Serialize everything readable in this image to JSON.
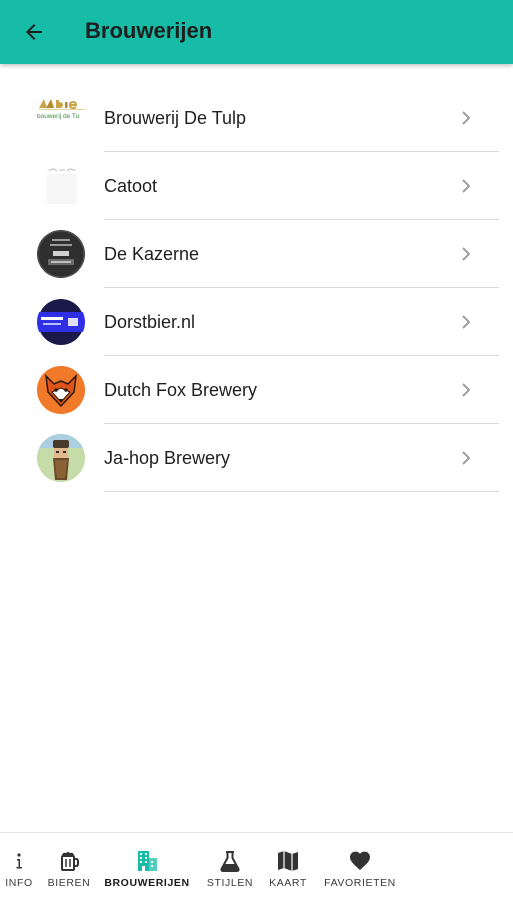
{
  "appbar": {
    "title": "Brouwerijen",
    "back_icon": "arrow-left-icon",
    "color": "#17bca7"
  },
  "breweries": [
    {
      "name": "Brouwerij De Tulp",
      "logo_text": "bouwerij de Tu"
    },
    {
      "name": "Catoot"
    },
    {
      "name": "De Kazerne"
    },
    {
      "name": "Dorstbier.nl"
    },
    {
      "name": "Dutch Fox Brewery"
    },
    {
      "name": "Ja-hop Brewery"
    }
  ],
  "bottom_nav": {
    "active": "brouwerijen",
    "accent": "#17bca7",
    "items": [
      {
        "label": "INFO",
        "icon": "info-icon"
      },
      {
        "label": "BIEREN",
        "icon": "beer-mug-icon"
      },
      {
        "label": "BROUWERIJEN",
        "icon": "building-icon"
      },
      {
        "label": "STIJLEN",
        "icon": "flask-icon"
      },
      {
        "label": "KAART",
        "icon": "map-icon"
      },
      {
        "label": "FAVORIETEN",
        "icon": "heart-icon"
      }
    ]
  }
}
